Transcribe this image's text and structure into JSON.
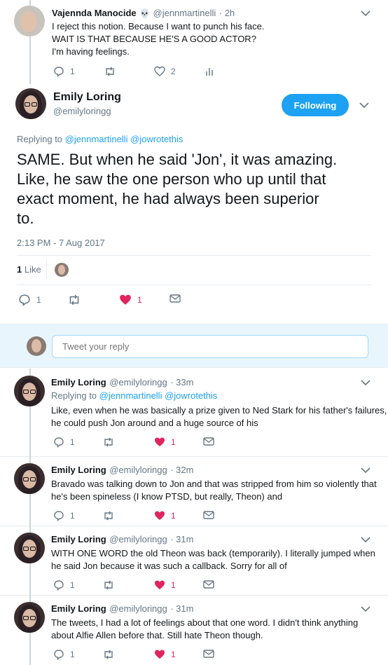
{
  "prev_tweet": {
    "name": "Vajennda Manocide",
    "handle": "@jennmartinelli",
    "time": "· 2h",
    "lines": [
      "I reject this notion. Because I want to punch his face.",
      "WAIT IS THAT BECAUSE HE'S A GOOD ACTOR?",
      "I'm having feelings."
    ],
    "replies": "1",
    "likes": "2"
  },
  "main_tweet": {
    "name": "Emily Loring",
    "handle": "@emilyloringg",
    "follow_label": "Following",
    "replying_prefix": "Replying to",
    "replying_to": "@jennmartinelli @jowrotethis",
    "text_lines": [
      "SAME. But when he said 'Jon', it was amazing.",
      "Like, he saw the one person who up until that",
      "exact moment, he had always been superior",
      "to."
    ],
    "timestamp": "2:13 PM - 7 Aug 2017",
    "like_count": "1",
    "like_label": "Like",
    "replies": "1",
    "likes": "1"
  },
  "reply_box": {
    "placeholder": "Tweet your reply"
  },
  "replies": [
    {
      "name": "Emily Loring",
      "handle": "@emilyloringg",
      "time": "· 33m",
      "replying_prefix": "Replying to",
      "replying_to": "@jennmartinelli @jowrotethis",
      "lines": [
        "Like, even when he was basically a prize given to Ned Stark for his father's failures,",
        "he could push Jon around and a huge source of his"
      ],
      "replies": "1",
      "likes": "1"
    },
    {
      "name": "Emily Loring",
      "handle": "@emilyloringg",
      "time": "· 32m",
      "lines": [
        "Bravado was talking down to Jon and that was stripped from him so violently that",
        "he's been spineless (I know PTSD, but really, Theon) and"
      ],
      "replies": "1",
      "likes": "1"
    },
    {
      "name": "Emily Loring",
      "handle": "@emilyloringg",
      "time": "· 31m",
      "lines": [
        "WITH ONE WORD the old Theon was back (temporarily).  I literally jumped when",
        "he said Jon because it was such a callback.  Sorry for all of"
      ],
      "replies": "1",
      "likes": "1"
    },
    {
      "name": "Emily Loring",
      "handle": "@emilyloringg",
      "time": "· 31m",
      "lines": [
        "The tweets, I had a lot of feelings about that one word.  I didn't think anything",
        "about Alfie Allen before that.  Still hate Theon though."
      ],
      "replies": "1",
      "likes": "1"
    }
  ],
  "colors": {
    "accent": "#1da1f2",
    "like_red": "#e0245e",
    "muted": "#657786"
  }
}
